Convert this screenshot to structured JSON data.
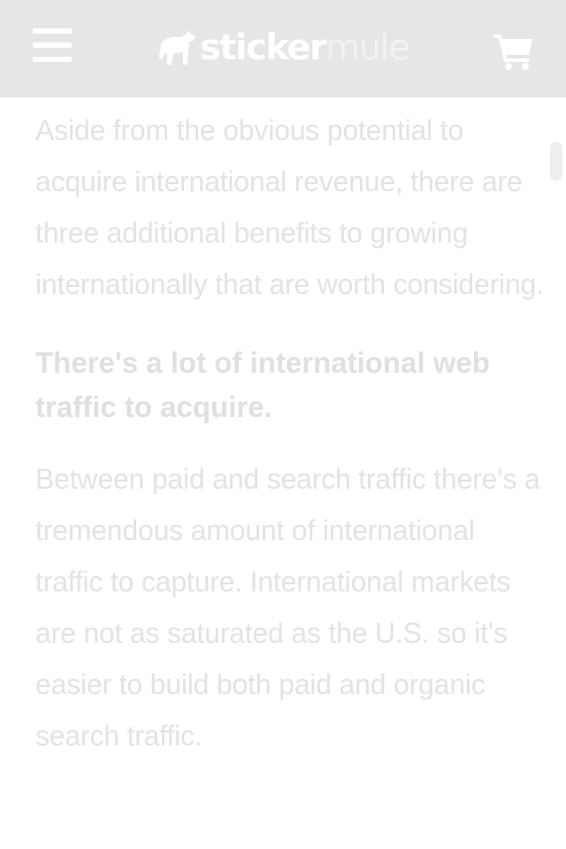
{
  "header": {
    "logo_primary": "sticker",
    "logo_secondary": "mule",
    "menu_icon": "hamburger-menu-icon",
    "cart_icon": "shopping-cart-icon"
  },
  "article": {
    "paragraph_1": "Aside from the obvious potential to acquire international revenue, there are three additional benefits to growing internationally that are worth considering.",
    "subheading_1": "There's a lot of international web traffic to acquire.",
    "paragraph_2": "Between paid and search traffic there’s a tremendous amount of international traffic to capture. International markets are not as saturated as the U.S. so it's easier to build both paid and organic search traffic."
  },
  "colors": {
    "header_bg": "#e6e6e6",
    "text_faded": "#e3e3e3"
  }
}
